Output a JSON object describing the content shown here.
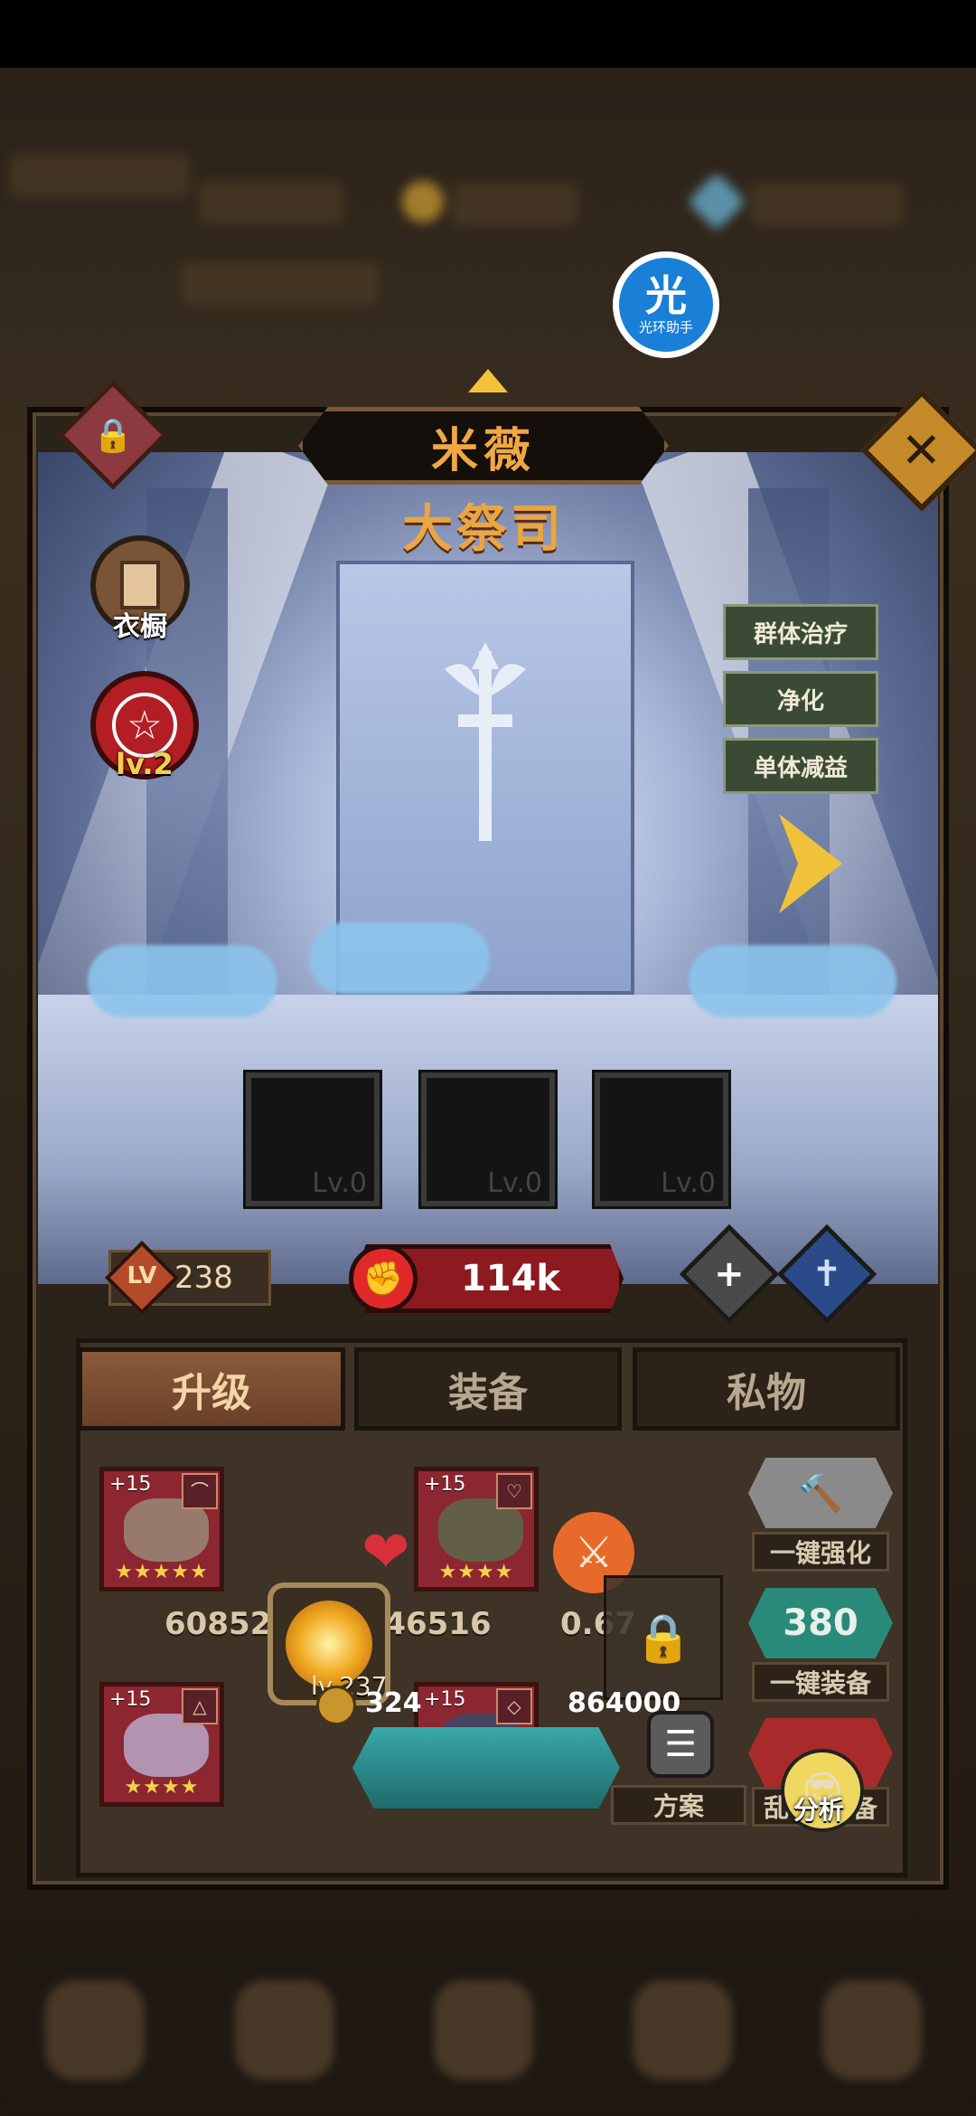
{
  "character": {
    "name": "米薇",
    "class": "大祭司",
    "wardrobe_label": "衣橱",
    "rank_label": "lv.2",
    "skills": [
      "群体治疗",
      "净化",
      "单体减益"
    ],
    "skill_slots": [
      "Lv.0",
      "Lv.0",
      "Lv.0"
    ],
    "level_badge": "LV",
    "level": "238",
    "power": "114k"
  },
  "overlay": {
    "assistant_icon_text": "光",
    "assistant_label": "光环助手"
  },
  "tabs": [
    "升级",
    "装备",
    "私物"
  ],
  "equipment": [
    {
      "plus": "+15",
      "stars": "★★★★★",
      "type_icon": "bow-icon"
    },
    {
      "plus": "+15",
      "stars": "★★★★",
      "type_icon": "heart-icon"
    },
    {
      "plus": "+15",
      "stars": "★★★★",
      "type_icon": "staff-icon"
    },
    {
      "plus": "+15",
      "stars": "★★★★★",
      "type_icon": "dagger-icon"
    }
  ],
  "stats": {
    "hp": "60852",
    "attack": "1146516",
    "crit": "0.67",
    "orb_level": "lv.237",
    "gold": "324",
    "gems": "864000"
  },
  "side_actions": {
    "enhance_label": "一键强化",
    "equip_count": "380",
    "equip_label": "一键装备",
    "plan_label": "方案",
    "analyze_label": "分析",
    "partial_label_left": "乱",
    "partial_label_right": "备"
  },
  "colors": {
    "accent_gold": "#f0a844",
    "power_red": "#8c1a20",
    "teal": "#3aa8a8",
    "equip_frame": "#8c2630"
  }
}
